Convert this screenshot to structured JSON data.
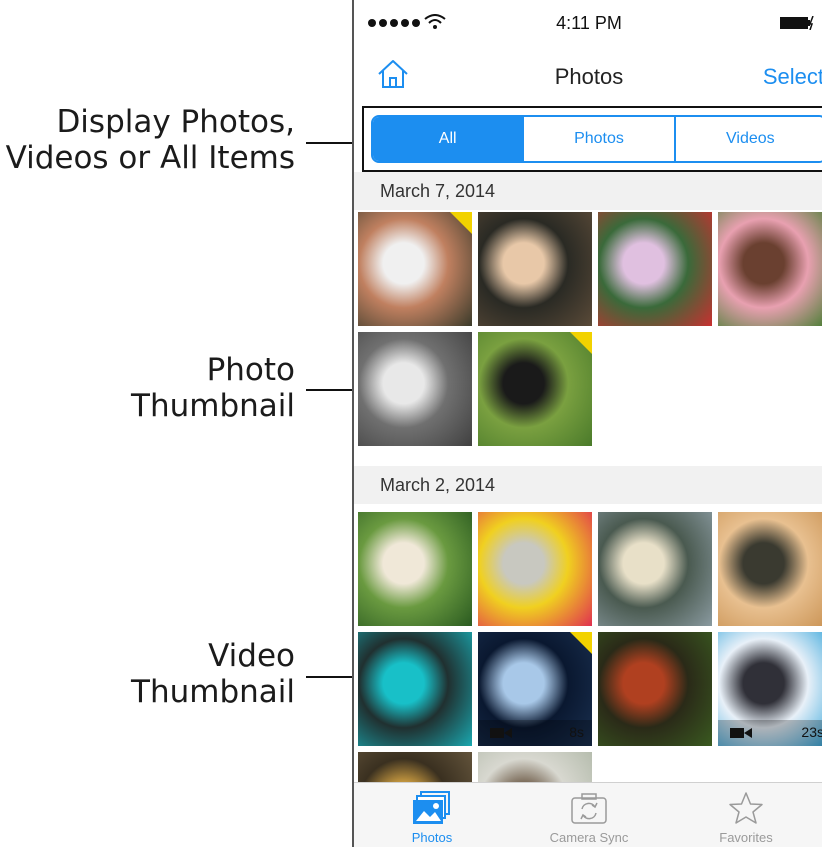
{
  "callouts": {
    "display": [
      "Display Photos,",
      "Videos or All Items"
    ],
    "photo": [
      "Photo",
      "Thumbnail"
    ],
    "video": [
      "Video",
      "Thumbnail"
    ]
  },
  "status_bar": {
    "time": "4:11 PM",
    "signal_dots": 5
  },
  "nav": {
    "title": "Photos",
    "select_label": "Select",
    "home_icon": "home-icon"
  },
  "segments": [
    {
      "label": "All",
      "selected": true
    },
    {
      "label": "Photos",
      "selected": false
    },
    {
      "label": "Videos",
      "selected": false
    }
  ],
  "sections": [
    {
      "date": "March 7, 2014",
      "items": [
        {
          "type": "photo",
          "subject": "dog",
          "new": true,
          "colors": [
            "#3a3a2a",
            "#f0f0f0",
            "#c08060"
          ]
        },
        {
          "type": "photo",
          "subject": "child",
          "new": false,
          "colors": [
            "#5a4a38",
            "#e8c8a8",
            "#2a2a24"
          ]
        },
        {
          "type": "photo",
          "subject": "costumes",
          "new": false,
          "colors": [
            "#c83030",
            "#e0c0e0",
            "#3a6a3a"
          ]
        },
        {
          "type": "photo",
          "subject": "girl-bubbles",
          "new": false,
          "colors": [
            "#3a7a28",
            "#6a4030",
            "#e8a0b0"
          ]
        },
        {
          "type": "photo",
          "subject": "space-shuttle",
          "new": false,
          "colors": [
            "#404040",
            "#e8e8e8",
            "#707070"
          ]
        },
        {
          "type": "photo",
          "subject": "black-dog",
          "new": true,
          "colors": [
            "#4a7a2a",
            "#1a1a1a",
            "#7aa040"
          ]
        }
      ]
    },
    {
      "date": "March 2, 2014",
      "items": [
        {
          "type": "photo",
          "subject": "heron",
          "new": false,
          "colors": [
            "#2a5a20",
            "#f0e8d8",
            "#6a9a40"
          ]
        },
        {
          "type": "photo",
          "subject": "bird-closeup",
          "new": false,
          "colors": [
            "#e03050",
            "#c8c8c0",
            "#f0d020"
          ]
        },
        {
          "type": "photo",
          "subject": "polar-bear",
          "new": false,
          "colors": [
            "#8a9aa0",
            "#e8e0c8",
            "#4a5a50"
          ]
        },
        {
          "type": "photo",
          "subject": "lioness",
          "new": false,
          "colors": [
            "#c89050",
            "#3a3a30",
            "#e8c090"
          ]
        },
        {
          "type": "photo",
          "subject": "penguin",
          "new": false,
          "colors": [
            "#1aa8b0",
            "#18c0c8",
            "#203030"
          ]
        },
        {
          "type": "video",
          "subject": "jellyfish",
          "new": true,
          "duration": "8s",
          "colors": [
            "#1a3050",
            "#a8c8e8",
            "#0a1830"
          ]
        },
        {
          "type": "photo",
          "subject": "red-panda",
          "new": false,
          "colors": [
            "#3a5a20",
            "#b04020",
            "#2a2a18"
          ]
        },
        {
          "type": "video",
          "subject": "sea-lion",
          "new": false,
          "duration": "23s",
          "colors": [
            "#28a0d8",
            "#303038",
            "#e8f0f8"
          ]
        },
        {
          "type": "photo",
          "subject": "partial-1",
          "new": false,
          "colors": [
            "#6a5a40",
            "#c89a40",
            "#3a3020"
          ]
        },
        {
          "type": "photo",
          "subject": "partial-2",
          "new": false,
          "colors": [
            "#b0b8a8",
            "#7a6a58",
            "#d8d8d0"
          ]
        }
      ]
    }
  ],
  "tabs": [
    {
      "label": "Photos",
      "icon": "photos-icon",
      "active": true
    },
    {
      "label": "Camera Sync",
      "icon": "camera-sync-icon",
      "active": false
    },
    {
      "label": "Favorites",
      "icon": "star-icon",
      "active": false
    }
  ],
  "colors": {
    "accent": "#1c8ef0",
    "new_badge": "#f2d200"
  }
}
